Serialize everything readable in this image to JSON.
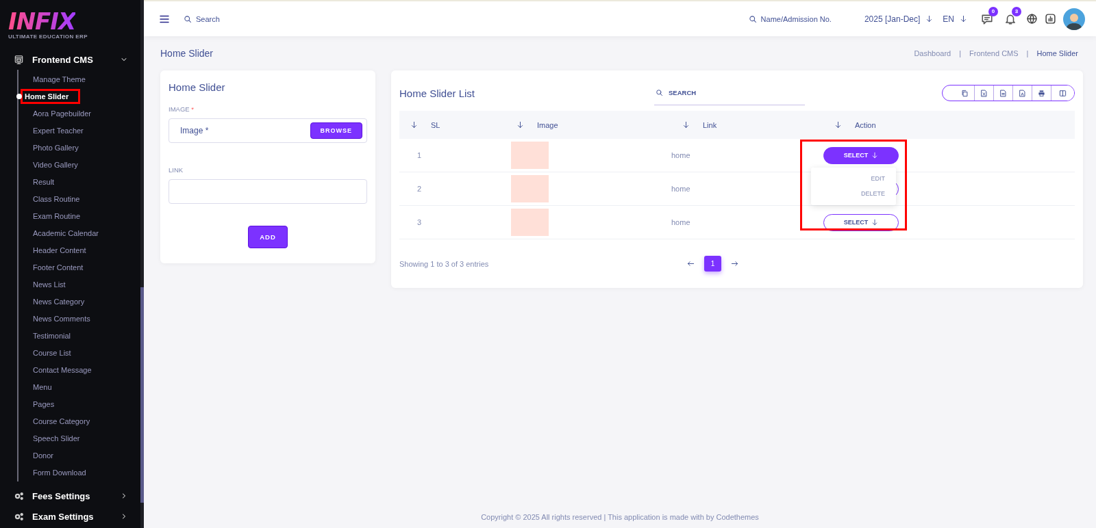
{
  "sidebar": {
    "logo": {
      "title": "INFIX",
      "subtitle": "ULTIMATE EDUCATION ERP"
    },
    "groups": [
      {
        "label": "Frontend CMS",
        "kind": "cms",
        "expanded": true,
        "children": [
          {
            "label": "Manage Theme",
            "selected": false,
            "annotated": false
          },
          {
            "label": "Home Slider",
            "selected": true,
            "annotated": true
          },
          {
            "label": "Aora Pagebuilder",
            "selected": false,
            "annotated": false
          },
          {
            "label": "Expert Teacher",
            "selected": false,
            "annotated": false
          },
          {
            "label": "Photo Gallery",
            "selected": false,
            "annotated": false
          },
          {
            "label": "Video Gallery",
            "selected": false,
            "annotated": false
          },
          {
            "label": "Result",
            "selected": false,
            "annotated": false
          },
          {
            "label": "Class Routine",
            "selected": false,
            "annotated": false
          },
          {
            "label": "Exam Routine",
            "selected": false,
            "annotated": false
          },
          {
            "label": "Academic Calendar",
            "selected": false,
            "annotated": false
          },
          {
            "label": "Header Content",
            "selected": false,
            "annotated": false
          },
          {
            "label": "Footer Content",
            "selected": false,
            "annotated": false
          },
          {
            "label": "News List",
            "selected": false,
            "annotated": false
          },
          {
            "label": "News Category",
            "selected": false,
            "annotated": false
          },
          {
            "label": "News Comments",
            "selected": false,
            "annotated": false
          },
          {
            "label": "Testimonial",
            "selected": false,
            "annotated": false
          },
          {
            "label": "Course List",
            "selected": false,
            "annotated": false
          },
          {
            "label": "Contact Message",
            "selected": false,
            "annotated": false
          },
          {
            "label": "Menu",
            "selected": false,
            "annotated": false
          },
          {
            "label": "Pages",
            "selected": false,
            "annotated": false
          },
          {
            "label": "Course Category",
            "selected": false,
            "annotated": false
          },
          {
            "label": "Speech Slider",
            "selected": false,
            "annotated": false
          },
          {
            "label": "Donor",
            "selected": false,
            "annotated": false
          },
          {
            "label": "Form Download",
            "selected": false,
            "annotated": false
          }
        ]
      },
      {
        "label": "Fees Settings",
        "kind": "gears",
        "expanded": false
      },
      {
        "label": "Exam Settings",
        "kind": "gears",
        "expanded": false
      }
    ]
  },
  "header": {
    "search": {
      "placeholder": "Search"
    },
    "student_search": {
      "placeholder": "Name/Admission No."
    },
    "session": "2025 [Jan-Dec]",
    "language": "EN",
    "badges": [
      {
        "kind": "chat",
        "count": "0"
      },
      {
        "kind": "bell",
        "count": "3"
      }
    ]
  },
  "page_title": "Home Slider",
  "breadcrumb": [
    {
      "label": "Dashboard",
      "selected": false
    },
    {
      "separator": "|",
      "label": "Frontend CMS",
      "selected": false
    },
    {
      "separator": "|",
      "label": "Home Slider",
      "selected": true
    }
  ],
  "form": {
    "title": "Home Slider",
    "image_label": "IMAGE",
    "required_mark": "*",
    "image_field": {
      "placeholder": "Image *"
    },
    "browse": "BROWSE",
    "link_label": "LINK",
    "add": "ADD"
  },
  "list": {
    "title": "Home Slider List",
    "search": {
      "placeholder": "SEARCH"
    },
    "export_buttons": [
      {
        "kind": "copy"
      },
      {
        "kind": "excel"
      },
      {
        "kind": "csv"
      },
      {
        "kind": "pdf"
      },
      {
        "kind": "print"
      },
      {
        "kind": "columns"
      }
    ],
    "columns": [
      "SL",
      "Image",
      "Link",
      "Action"
    ],
    "rows": [
      {
        "sl": "1",
        "link": "home",
        "action": {
          "label": "SELECT",
          "open": true
        }
      },
      {
        "sl": "2",
        "link": "home",
        "action": {
          "open": false
        }
      },
      {
        "sl": "3",
        "link": "home",
        "action": {
          "label": "SELECT",
          "open": false
        }
      }
    ],
    "menu": {
      "items": [
        "EDIT",
        "DELETE"
      ],
      "annotated": true
    },
    "info": "Showing 1 to 3 of 3 entries",
    "pages": [
      {
        "label": "1",
        "selected": true
      }
    ]
  },
  "footer": "Copyright © 2025 All rights reserved | This application is made with by Codethemes"
}
